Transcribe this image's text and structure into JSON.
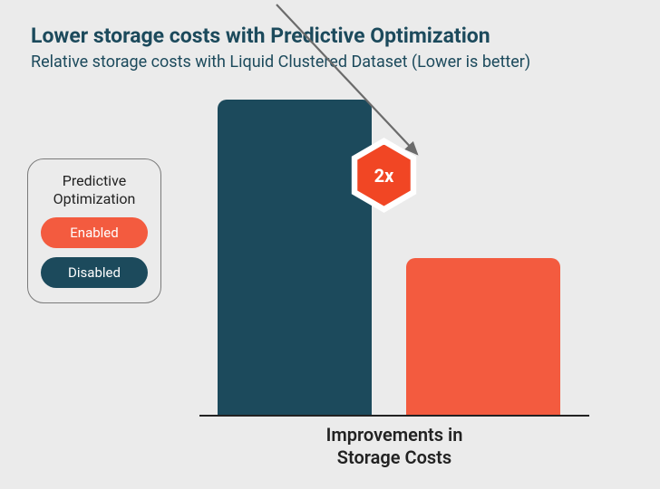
{
  "title": "Lower storage costs with Predictive Optimization",
  "subtitle": "Relative storage costs with Liquid Clustered Dataset (Lower is better)",
  "legend": {
    "title": "Predictive Optimization",
    "enabled_label": "Enabled",
    "disabled_label": "Disabled"
  },
  "annotation": {
    "factor_label": "2x"
  },
  "axis_label": "Improvements in Storage Costs",
  "colors": {
    "enabled": "#f35b3f",
    "disabled": "#1c4a5c",
    "hex_fill": "#f14624",
    "bg": "#ebebeb"
  },
  "chart_data": {
    "type": "bar",
    "title": "Lower storage costs with Predictive Optimization",
    "subtitle": "Relative storage costs with Liquid Clustered Dataset (Lower is better)",
    "xlabel": "Improvements in Storage Costs",
    "ylabel": "",
    "categories": [
      "Disabled",
      "Enabled"
    ],
    "values": [
      2.0,
      1.0
    ],
    "ylim": [
      0,
      2.0
    ],
    "legend": {
      "title": "Predictive Optimization",
      "entries": [
        "Enabled",
        "Disabled"
      ]
    },
    "annotations": [
      {
        "text": "2x",
        "between": [
          "Disabled",
          "Enabled"
        ]
      }
    ],
    "series_colors": {
      "Disabled": "#1c4a5c",
      "Enabled": "#f35b3f"
    }
  }
}
